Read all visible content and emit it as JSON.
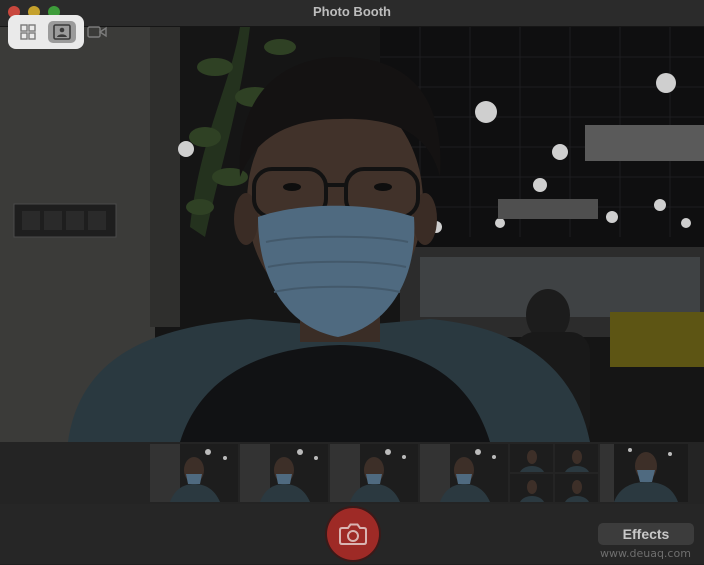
{
  "window": {
    "title": "Photo Booth"
  },
  "icons": {
    "close": "close-traffic-light",
    "minimize": "minimize-traffic-light",
    "zoom": "zoom-traffic-light",
    "grid_view": "grid-view-icon",
    "single_photo": "single-photo-icon",
    "video": "video-camera-icon",
    "camera": "camera-icon"
  },
  "colors": {
    "close": "#c9473d",
    "minimize": "#c5a12c",
    "zoom": "#3d9c3a",
    "shutter": "#9e2a26",
    "mode_group_highlight": "#eaeaea"
  },
  "toolbar": {
    "effects_label": "Effects"
  },
  "watermark": {
    "text": "www.deuaq.com"
  }
}
